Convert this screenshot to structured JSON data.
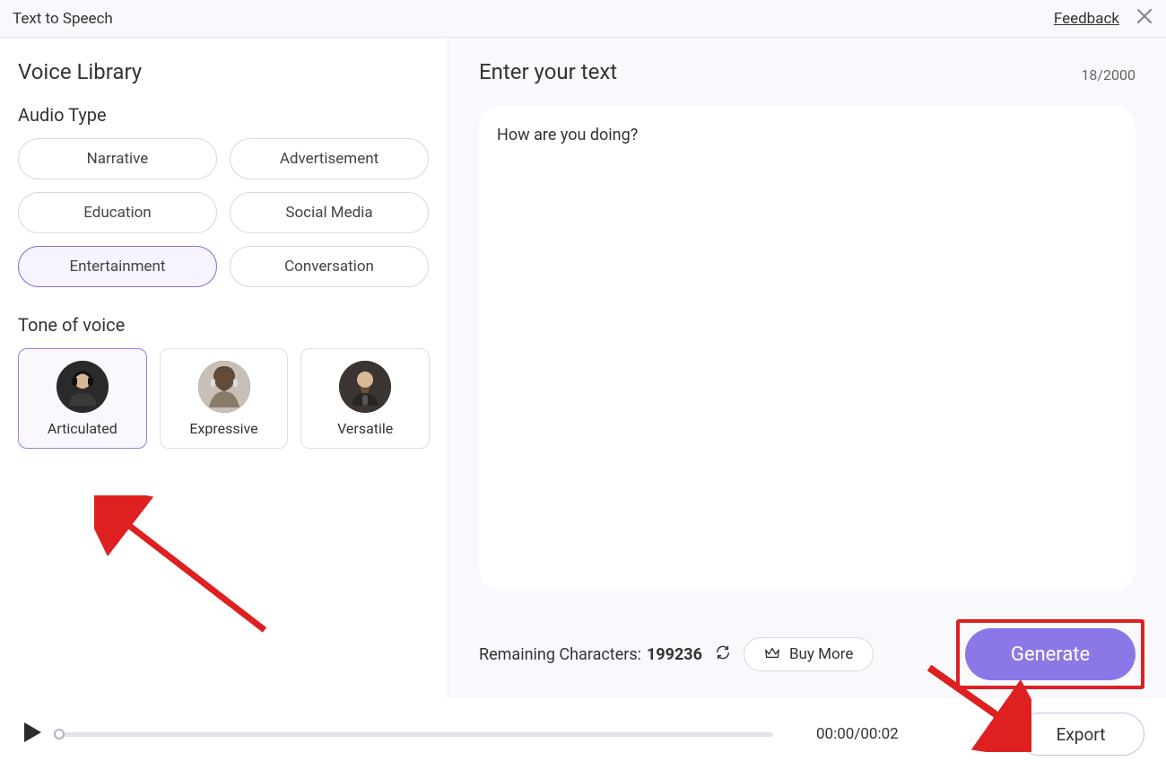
{
  "header": {
    "title": "Text to Speech",
    "feedback_label": "Feedback"
  },
  "left": {
    "title": "Voice Library",
    "audio_type_label": "Audio Type",
    "audio_types": [
      "Narrative",
      "Advertisement",
      "Education",
      "Social Media",
      "Entertainment",
      "Conversation"
    ],
    "audio_type_selected_index": 4,
    "tone_label": "Tone of voice",
    "tones": [
      "Articulated",
      "Expressive",
      "Versatile"
    ],
    "tone_selected_index": 0
  },
  "right": {
    "title": "Enter your text",
    "text_content": "How are you doing?",
    "char_count": "18/2000",
    "remaining_label": "Remaining Characters:",
    "remaining_value": "199236",
    "buy_more_label": "Buy More",
    "generate_label": "Generate"
  },
  "player": {
    "time": "00:00/00:02",
    "export_label": "Export"
  },
  "colors": {
    "accent": "#8b78e6",
    "annotation_red": "#de2020"
  }
}
